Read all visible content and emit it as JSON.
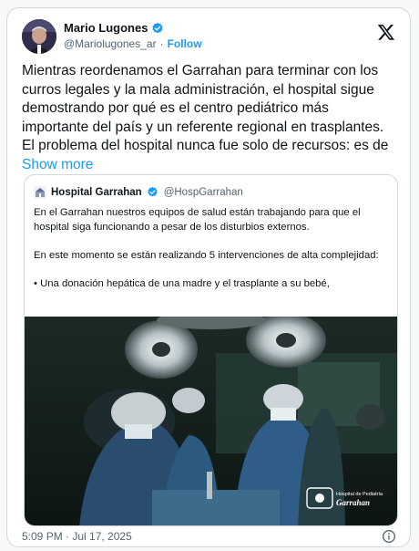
{
  "author": {
    "name": "Mario Lugones",
    "handle": "@Mariolugones_ar",
    "separator": "·",
    "follow_label": "Follow"
  },
  "tweet": {
    "text": "Mientras reordenamos el Garrahan para terminar con los curros legales y la mala administración, el hospital sigue demostrando por qué es el centro pediátrico más importante del país y un referente regional en trasplantes. El problema del hospital nunca fue solo de recursos: es de",
    "show_more": "Show more"
  },
  "quote": {
    "name": "Hospital Garrahan",
    "handle": "@HospGarrahan",
    "paragraph1": "En el Garrahan nuestros equipos de salud están trabajando para que el hospital siga funcionando a pesar de los disturbios externos.",
    "paragraph2": "En este momento se están realizando 5 intervenciones de alta complejidad:",
    "bullet": "•  Una donación hepática de una madre y el trasplante a su bebé,",
    "image_logo_text": "Hospital de Pediatría",
    "image_logo_brand": "Garrahan"
  },
  "footer": {
    "timestamp": "5:09 PM · Jul 17, 2025"
  },
  "colors": {
    "accent": "#1d9bf0",
    "text": "#0f1419",
    "muted": "#536471",
    "border": "#cfd9de"
  },
  "icons": [
    "verified-badge-icon",
    "x-logo-icon",
    "info-icon"
  ]
}
